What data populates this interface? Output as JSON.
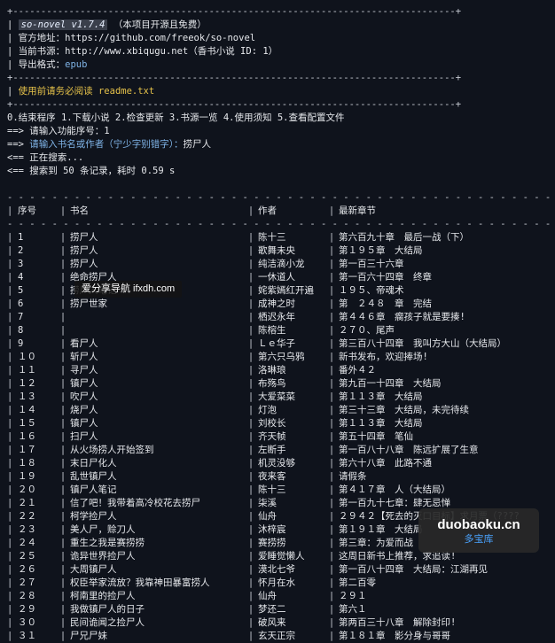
{
  "banner": {
    "app_name": "so-novel v1.7.4",
    "free_note": "（本项目开源且免费）",
    "official_label": "官方地址：",
    "official_url": "https://github.com/freeok/so-novel",
    "source_label": "当前书源：",
    "source_value": "http://www.xbiqugu.net（香书小说 ID: 1）",
    "format_label": "导出格式：",
    "format_value": "epub",
    "readme_notice": "使用前请务必阅读 readme.txt"
  },
  "menu": "0.结束程序 1.下载小说 2.检查更新 3.书源一览 4.使用须知 5.查看配置文件",
  "prompts": {
    "func_prompt": "==> 请输入功能序号：1",
    "search_prompt_prefix": "==> ",
    "search_prompt_hint": "请输入书名或作者（宁少字别错字）：",
    "search_input": "捞尸人",
    "searching": "<== 正在搜索...",
    "result_summary": "<== 搜索到 50 条记录，耗时 0.59 s"
  },
  "table": {
    "headers": [
      "序号",
      "书名",
      "作者",
      "最新章节"
    ],
    "rows": [
      [
        "1",
        "捞尸人",
        "陈十三",
        "第六百九十章　最后一战（下）"
      ],
      [
        "2",
        "捞尸人",
        "歌舞未央",
        "第１９５章　大结局"
      ],
      [
        "3",
        "捞尸人",
        "纯洁滴小龙",
        "第一百三十六章"
      ],
      [
        "4",
        "绝命捞尸人",
        "一休道人",
        "第一百六十四章　终章"
      ],
      [
        "5",
        "捞尸人笔记",
        "姹紫嫣红开遍",
        "１９５、帝魂术"
      ],
      [
        "6",
        "捞尸世家",
        "成神之时",
        "第　２４８　章　完结"
      ],
      [
        "7",
        "",
        "栖迟永年",
        "第４４６章　瘸孩子就是要揍!"
      ],
      [
        "8",
        "",
        "陈榕生",
        "２７０、尾声"
      ],
      [
        "9",
        "看尸人",
        "Ｌｅ华子",
        "第三百八十四章　我叫方大山（大结局）"
      ],
      [
        "１０",
        "斩尸人",
        "第六只乌鸦",
        "新书发布，欢迎捧场!"
      ],
      [
        "１１",
        "寻尸人",
        "洛琳琅",
        "番外４２"
      ],
      [
        "１２",
        "镇尸人",
        "布殇鸟",
        "第九百一十四章　大结局"
      ],
      [
        "１３",
        "吹尸人",
        "大爱菜菜",
        "第１１３章　大结局"
      ],
      [
        "１４",
        "烧尸人",
        "灯泡",
        "第三十三章　大结局，未完待续"
      ],
      [
        "１５",
        "镇尸人",
        "刘校长",
        "第１１３章　大结局"
      ],
      [
        "１６",
        "扫尸人",
        "齐天帧",
        "第五十四章　笔仙"
      ],
      [
        "１７",
        "从火场捞人开始签到",
        "左断手",
        "第一百八十八章　陈远扩展了生意"
      ],
      [
        "１８",
        "末日尸化人",
        "机灵没够",
        "第六十八章　此路不通"
      ],
      [
        "１９",
        "乱世镇尸人",
        "夜来客",
        "请假条"
      ],
      [
        "２０",
        "镇尸人笔记",
        "陈十三",
        "第４１７章　人（大结局）"
      ],
      [
        "２１",
        "信了吧！我带着高冷校花去捞尸",
        "柒溪",
        "第一百九十七章：肆无忌惮"
      ],
      [
        "２２",
        "柯学捡尸人",
        "仙舟",
        "２９４２【死去的灭口目标】求月票（????"
      ],
      [
        "２３",
        "美人尸，赊刀人",
        "沐梓宸",
        "第１９１章　大结局"
      ],
      [
        "２４",
        "重生之我是赛捞捞",
        "赛捞捞",
        "第三章：为爱而战"
      ],
      [
        "２５",
        "诡异世界捡尸人",
        "爱睡觉懒人",
        "这周日新书上推荐，求追读!"
      ],
      [
        "２６",
        "大周镇尸人",
        "漠北七爷",
        "第一百八十四章　大结局：江湖再见"
      ],
      [
        "２７",
        "权臣举家流放？我靠神田暴富捞人",
        "怀月在水",
        "第二百零"
      ],
      [
        "２８",
        "柯南里的捡尸人",
        "仙舟",
        "２９１"
      ],
      [
        "２９",
        "我做镇尸人的日子",
        "梦还二",
        "第六１"
      ],
      [
        "３０",
        "民间诡闻之捡尸人",
        "破风来",
        "第两百三十八章　解除封印!"
      ],
      [
        "３１",
        "尸兄尸妹",
        "玄天正宗",
        "第１８１章　影分身与哥哥"
      ]
    ]
  },
  "watermark": "爱分享导航 ifxdh.com",
  "logo": {
    "main": "duobaoku.cn",
    "sub": "多宝库"
  }
}
